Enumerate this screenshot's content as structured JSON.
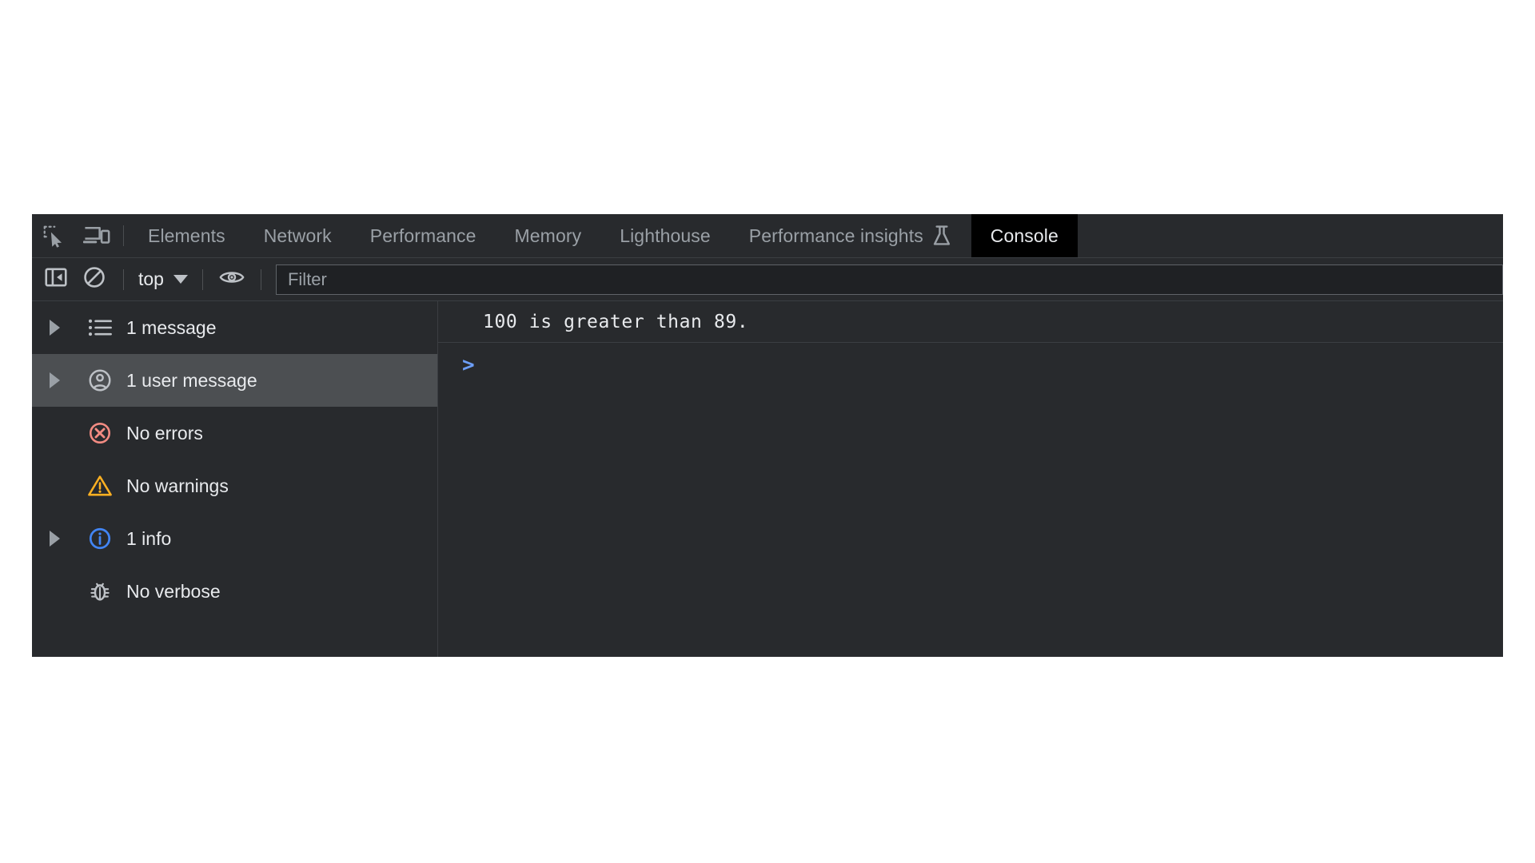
{
  "devtools": {
    "toolbar_icons": [
      {
        "name": "inspect-element-icon",
        "title": "Inspect element"
      },
      {
        "name": "device-toolbar-icon",
        "title": "Toggle device toolbar"
      }
    ],
    "tabs": [
      {
        "label": "Elements",
        "active": false,
        "icon": null
      },
      {
        "label": "Network",
        "active": false,
        "icon": null
      },
      {
        "label": "Performance",
        "active": false,
        "icon": null
      },
      {
        "label": "Memory",
        "active": false,
        "icon": null
      },
      {
        "label": "Lighthouse",
        "active": false,
        "icon": null
      },
      {
        "label": "Performance insights",
        "active": false,
        "icon": "flask-icon"
      },
      {
        "label": "Console",
        "active": true,
        "icon": null
      }
    ]
  },
  "console_toolbar": {
    "sidebar_toggle_icon": "sidebar-toggle-icon",
    "clear_console_icon": "clear-console-icon",
    "context_label": "top",
    "context_caret_icon": "chevron-down-icon",
    "live_expression_icon": "eye-icon",
    "filter": {
      "placeholder": "Filter",
      "value": ""
    }
  },
  "sidebar": {
    "items": [
      {
        "label": "1 message",
        "icon": "list-icon",
        "expandable": true,
        "selected": false
      },
      {
        "label": "1 user message",
        "icon": "user-icon",
        "expandable": true,
        "selected": true
      },
      {
        "label": "No errors",
        "icon": "error-icon",
        "expandable": false,
        "selected": false
      },
      {
        "label": "No warnings",
        "icon": "warning-icon",
        "expandable": false,
        "selected": false
      },
      {
        "label": "1 info",
        "icon": "info-icon",
        "expandable": true,
        "selected": false
      },
      {
        "label": "No verbose",
        "icon": "bug-icon",
        "expandable": false,
        "selected": false
      }
    ]
  },
  "console_output": {
    "messages": [
      {
        "text": "100 is greater than 89."
      }
    ],
    "prompt_symbol": ">",
    "prompt_value": ""
  },
  "colors": {
    "panel_bg": "#282a2d",
    "active_tab_bg": "#000000",
    "selected_row_bg": "#4c4f52",
    "text_primary": "#e8eaed",
    "text_secondary": "#9aa0a6",
    "error_red": "#f28b82",
    "warning_orange": "#fdb022",
    "info_blue": "#4285f4",
    "prompt_blue": "#6c9ef8"
  }
}
